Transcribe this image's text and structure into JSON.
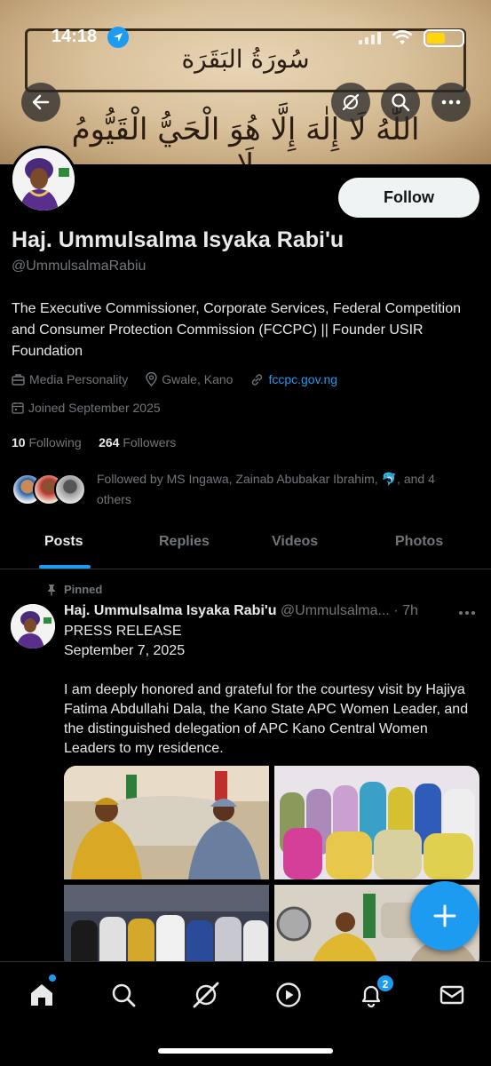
{
  "status": {
    "time": "14:18"
  },
  "banner": {
    "sura": "سُورَةُ البَقَرَة",
    "ayah": "اللّٰهُ لَا إِلٰهَ إِلَّا هُوَ الْحَيُّ الْقَيُّومُ لَا"
  },
  "profile": {
    "name": "Haj. Ummulsalma Isyaka Rabi'u",
    "handle": "@UmmulsalmaRabiu",
    "follow_label": "Follow",
    "bio": "The Executive Commissioner, Corporate Services, Federal Competition and Consumer Protection Commission (FCCPC) || Founder USIR Foundation",
    "category": "Media Personality",
    "location": "Gwale, Kano",
    "website": "fccpc.gov.ng",
    "joined": "Joined September 2025",
    "following_count": "10",
    "following_label": "Following",
    "followers_count": "264",
    "followers_label": "Followers",
    "followed_by": "Followed by MS Ingawa, Zainab Abubakar Ibrahim, 🐬, and 4 others"
  },
  "tabs": [
    {
      "label": "Posts",
      "active": true
    },
    {
      "label": "Replies",
      "active": false
    },
    {
      "label": "Videos",
      "active": false
    },
    {
      "label": "Photos",
      "active": false
    }
  ],
  "post": {
    "pinned_label": "Pinned",
    "author": "Haj. Ummulsalma Isyaka Rabi'u",
    "handle_time": "@Ummulsalma... · 7h",
    "line1": "PRESS RELEASE",
    "line2": "September 7, 2025",
    "paragraph": "I am deeply honored and grateful for the courtesy visit by Hajiya Fatima Abdullahi Dala, the Kano State APC Women Leader, and the distinguished delegation of APC Kano Central Women Leaders to my residence."
  },
  "nav": {
    "notification_count": "2"
  },
  "colors": {
    "accent": "#1d9bf0",
    "background": "#000000",
    "text": "#e7e9ea",
    "muted": "#71767b"
  }
}
